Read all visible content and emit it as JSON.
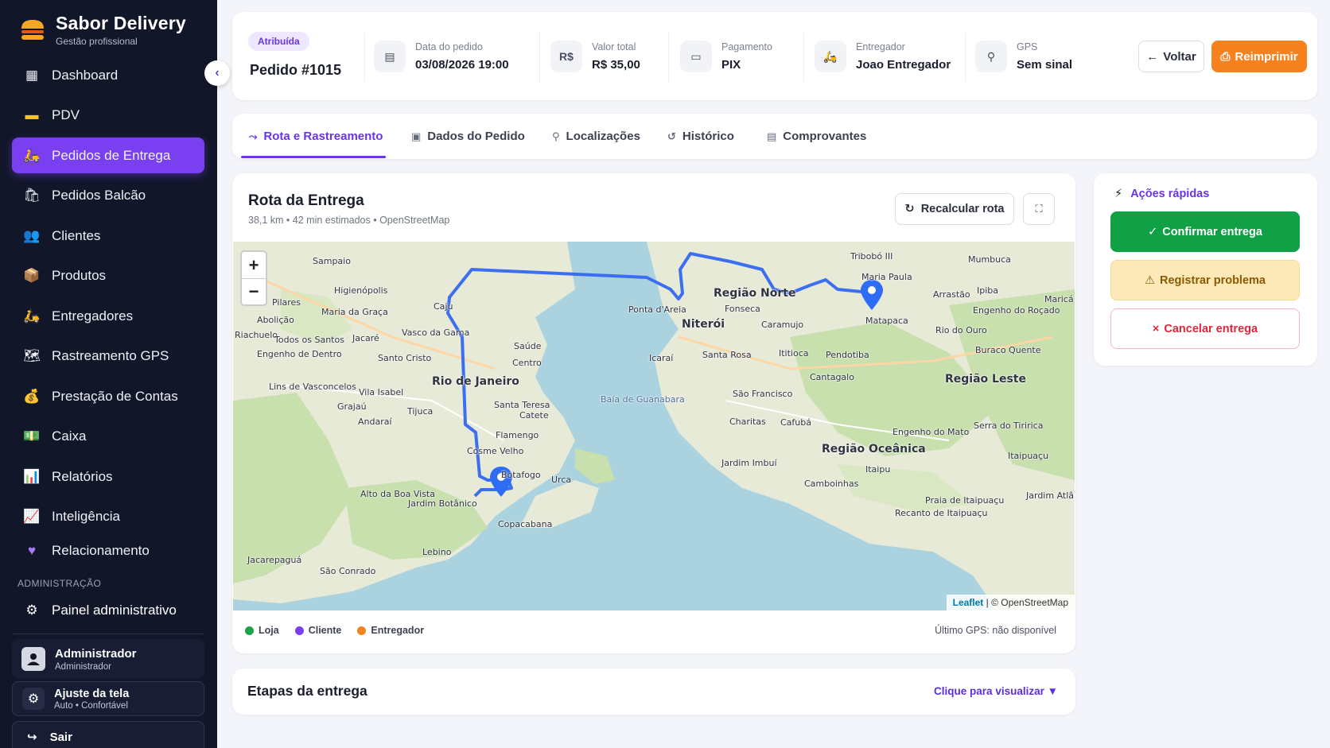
{
  "app": {
    "name": "Sabor Delivery",
    "subtitle": "Gestão profissional"
  },
  "sidebar": {
    "items": [
      {
        "label": "Dashboard",
        "icon": "dashboard-icon"
      },
      {
        "label": "PDV",
        "icon": "card-icon"
      },
      {
        "label": "Pedidos de Entrega",
        "icon": "scooter-icon",
        "active": true
      },
      {
        "label": "Pedidos Balcão",
        "icon": "shopping-bag-icon"
      },
      {
        "label": "Clientes",
        "icon": "users-icon"
      },
      {
        "label": "Produtos",
        "icon": "box-icon"
      },
      {
        "label": "Entregadores",
        "icon": "delivery-scooter-icon"
      },
      {
        "label": "Rastreamento GPS",
        "icon": "map-icon"
      },
      {
        "label": "Prestação de Contas",
        "icon": "money-bag-icon"
      },
      {
        "label": "Caixa",
        "icon": "cash-icon"
      },
      {
        "label": "Relatórios",
        "icon": "bar-chart-icon"
      },
      {
        "label": "Inteligência",
        "icon": "trend-chart-icon"
      },
      {
        "label": "Relacionamento",
        "icon": "heart-icon"
      }
    ],
    "section_admin": "ADMINISTRAÇÃO",
    "admin_item": "Painel administrativo",
    "user": {
      "name": "Administrador",
      "role": "Administrador"
    },
    "adjust": {
      "title": "Ajuste da tela",
      "subtitle": "Auto • Confortável"
    },
    "logout": "Sair"
  },
  "header": {
    "status": "Atribuída",
    "order": "Pedido #1015",
    "info": [
      {
        "label": "Data do pedido",
        "value": "03/08/2026 19:00",
        "icon": "calendar-icon"
      },
      {
        "label": "Valor total",
        "value": "R$ 35,00",
        "icon": "currency-icon",
        "icon_text": "R$"
      },
      {
        "label": "Pagamento",
        "value": "PIX",
        "icon": "payment-card-icon"
      },
      {
        "label": "Entregador",
        "value": "Joao Entregador",
        "icon": "courier-icon"
      },
      {
        "label": "GPS",
        "value": "Sem sinal",
        "icon": "location-pin-icon"
      }
    ],
    "back_label": "Voltar",
    "print_label": "Reimprimir"
  },
  "tabs": [
    {
      "label": "Rota e Rastreamento",
      "icon": "route-icon",
      "active": true
    },
    {
      "label": "Dados do Pedido",
      "icon": "receipt-icon"
    },
    {
      "label": "Localizações",
      "icon": "pin-icon"
    },
    {
      "label": "Histórico",
      "icon": "history-icon"
    },
    {
      "label": "Comprovantes",
      "icon": "document-icon"
    }
  ],
  "map_panel": {
    "title": "Rota da Entrega",
    "subtitle": "38,1 km • 42 min estimados • OpenStreetMap",
    "recalc_label": "Recalcular rota",
    "attribution_leaflet": "Leaflet",
    "attribution_osm": "| © OpenStreetMap",
    "legend": [
      {
        "label": "Loja",
        "color": "#1fa34a"
      },
      {
        "label": "Cliente",
        "color": "#7b3ff2"
      },
      {
        "label": "Entregador",
        "color": "#f5821f"
      }
    ],
    "gps_status": "Último GPS: não disponível",
    "route_color": "#3b6ff0",
    "place_labels": [
      "Sampaio",
      "Higienópolis",
      "Pilares",
      "Maria da Graça",
      "Abolição",
      "Riachuelo",
      "Todos os Santos",
      "Jacaré",
      "Vasco da Gama",
      "Caju",
      "Engenho de Dentro",
      "Santo Cristo",
      "Saúde",
      "Centro",
      "Rio de Janeiro",
      "Lins de Vasconcelos",
      "Vila Isabel",
      "Grajaú",
      "Tijuca",
      "Andaraí",
      "Santa Teresa",
      "Catete",
      "Flamengo",
      "Cosme Velho",
      "Botafogo",
      "Urca",
      "Alto da Boa Vista",
      "Jardim Botânico",
      "Copacabana",
      "Lebino",
      "São Conrado",
      "Jacarepaguá",
      "Baía de Guanabara",
      "Ponta d'Areia",
      "Niterói",
      "Região Norte",
      "Fonseca",
      "Caramujo",
      "Santa Rosa",
      "São Francisco",
      "Icaraí",
      "Ititioca",
      "Pendotiba",
      "Cantagalo",
      "Charitas",
      "Cafubá",
      "Região Oceânica",
      "Jardim Imbuí",
      "Camboinhas",
      "Itaipu",
      "Engenho do Mato",
      "Maria Paula",
      "Arrastão",
      "Ipiba",
      "Tribobó III",
      "Região Leste",
      "Rio do Ouro",
      "Buraco Quente",
      "Itaipuaçu",
      "Maricá",
      "Recanto de Itaipuaçu",
      "Praia de Itaipuaçu",
      "Jardim Atlântico Central",
      "Mumbuca",
      "Matapaca",
      "Engenho do Roçado",
      "Serra do Tiririca"
    ]
  },
  "quick_actions": {
    "title": "Ações rápidas",
    "confirm": "Confirmar entrega",
    "problem": "Registrar problema",
    "cancel": "Cancelar entrega"
  },
  "steps": {
    "title": "Etapas da entrega",
    "link": "Clique para visualizar"
  }
}
